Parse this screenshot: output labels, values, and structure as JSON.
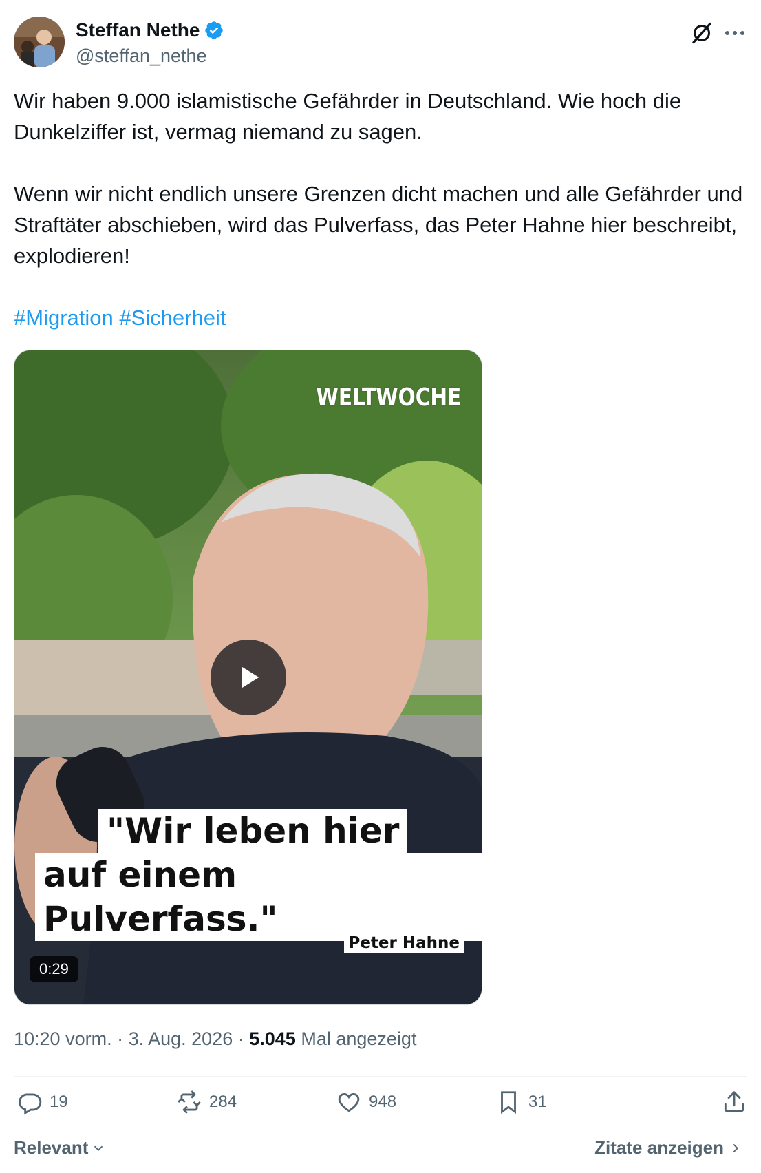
{
  "author": {
    "display_name": "Steffan Nethe",
    "handle": "@steffan_nethe",
    "verified": true,
    "avatar_icon": "profile-photo"
  },
  "tweet": {
    "paragraph1": "Wir haben 9.000 islamistische Gefährder in Deutschland. Wie hoch die Dunkelziffer ist, vermag niemand zu sagen.",
    "paragraph2": "Wenn wir nicht endlich unsere Grenzen dicht machen und alle Gefährder und Straftäter abschieben, wird das Pulverfass, das Peter Hahne hier beschreibt, explodieren!",
    "hashtags": [
      "#Migration",
      "#Sicherheit"
    ]
  },
  "video": {
    "watermark": "WELTWOCHE",
    "quote_line1": "\"Wir leben hier",
    "quote_line2": "auf einem Pulverfass.\"",
    "speaker": "Peter Hahne",
    "duration": "0:29"
  },
  "meta": {
    "time": "10:20 vorm.",
    "date": "3. Aug. 2026",
    "views": "5.045",
    "views_label": "Mal angezeigt"
  },
  "actions": {
    "replies": "19",
    "reposts": "284",
    "likes": "948",
    "bookmarks": "31"
  },
  "footer": {
    "sort_label": "Relevant",
    "quotes_label": "Zitate anzeigen"
  },
  "colors": {
    "accent": "#1d9bf0",
    "secondary_text": "#536471",
    "primary_text": "#0f1419"
  }
}
